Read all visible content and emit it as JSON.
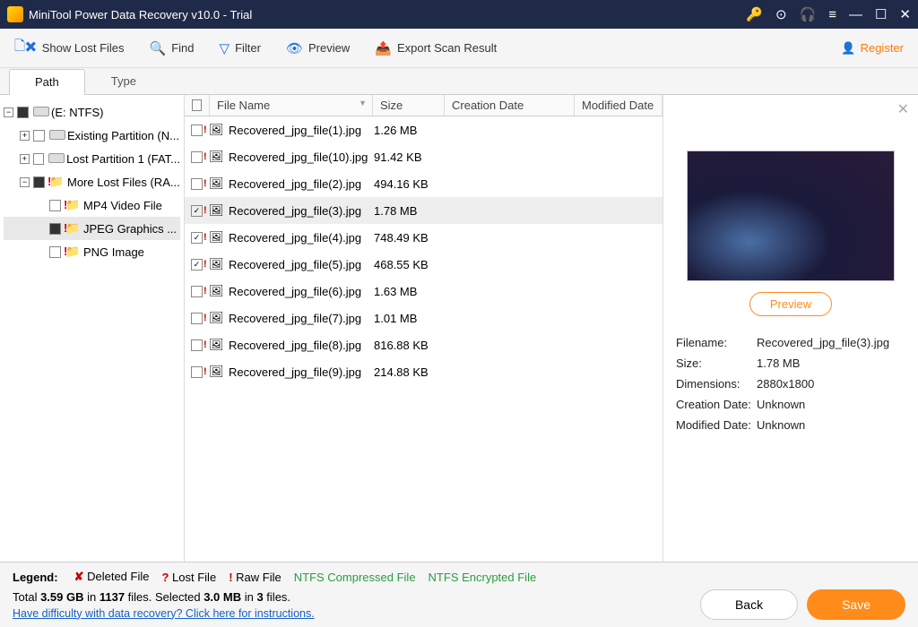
{
  "title": "MiniTool Power Data Recovery v10.0 - Trial",
  "toolbar": {
    "show_lost": "Show Lost Files",
    "find": "Find",
    "filter": "Filter",
    "preview": "Preview",
    "export": "Export Scan Result",
    "register": "Register"
  },
  "tabs": {
    "path": "Path",
    "type": "Type"
  },
  "tree": [
    {
      "label": "(E: NTFS)",
      "exp": "−",
      "cb": "filled",
      "icon": "drive",
      "ind": 0
    },
    {
      "label": "Existing Partition (N...",
      "exp": "+",
      "cb": "",
      "icon": "drive",
      "ind": 1
    },
    {
      "label": "Lost Partition 1 (FAT...",
      "exp": "+",
      "cb": "",
      "icon": "drive",
      "ind": 1
    },
    {
      "label": "More Lost Files (RA...",
      "exp": "−",
      "cb": "filled",
      "icon": "folder-ex",
      "ind": 1
    },
    {
      "label": "MP4 Video File",
      "exp": "",
      "cb": "",
      "icon": "folder-ex",
      "ind": 2
    },
    {
      "label": "JPEG Graphics ...",
      "exp": "",
      "cb": "filled",
      "icon": "folder-ex",
      "ind": 2,
      "sel": true
    },
    {
      "label": "PNG Image",
      "exp": "",
      "cb": "",
      "icon": "folder-ex",
      "ind": 2
    }
  ],
  "columns": {
    "name": "File Name",
    "size": "Size",
    "cdate": "Creation Date",
    "mdate": "Modified Date"
  },
  "files": [
    {
      "name": "Recovered_jpg_file(1).jpg",
      "size": "1.26 MB",
      "checked": false
    },
    {
      "name": "Recovered_jpg_file(10).jpg",
      "size": "91.42 KB",
      "checked": false
    },
    {
      "name": "Recovered_jpg_file(2).jpg",
      "size": "494.16 KB",
      "checked": false
    },
    {
      "name": "Recovered_jpg_file(3).jpg",
      "size": "1.78 MB",
      "checked": true,
      "sel": true
    },
    {
      "name": "Recovered_jpg_file(4).jpg",
      "size": "748.49 KB",
      "checked": true
    },
    {
      "name": "Recovered_jpg_file(5).jpg",
      "size": "468.55 KB",
      "checked": true
    },
    {
      "name": "Recovered_jpg_file(6).jpg",
      "size": "1.63 MB",
      "checked": false
    },
    {
      "name": "Recovered_jpg_file(7).jpg",
      "size": "1.01 MB",
      "checked": false
    },
    {
      "name": "Recovered_jpg_file(8).jpg",
      "size": "816.88 KB",
      "checked": false
    },
    {
      "name": "Recovered_jpg_file(9).jpg",
      "size": "214.88 KB",
      "checked": false
    }
  ],
  "preview": {
    "button": "Preview",
    "filename_k": "Filename:",
    "filename_v": "Recovered_jpg_file(3).jpg",
    "size_k": "Size:",
    "size_v": "1.78 MB",
    "dim_k": "Dimensions:",
    "dim_v": "2880x1800",
    "cdate_k": "Creation Date:",
    "cdate_v": "Unknown",
    "mdate_k": "Modified Date:",
    "mdate_v": "Unknown"
  },
  "legend": {
    "title": "Legend:",
    "deleted": "Deleted File",
    "lost": "Lost File",
    "raw": "Raw File",
    "compressed": "NTFS Compressed File",
    "encrypted": "NTFS Encrypted File"
  },
  "stats": {
    "total_pre": "Total ",
    "total_size": "3.59 GB",
    "in": " in ",
    "total_files": "1137",
    "files_sel": " files.  Selected ",
    "sel_size": "3.0 MB",
    "in2": " in ",
    "sel_files": "3",
    "tail": " files."
  },
  "help": "Have difficulty with data recovery? Click here for instructions.",
  "buttons": {
    "back": "Back",
    "save": "Save"
  }
}
